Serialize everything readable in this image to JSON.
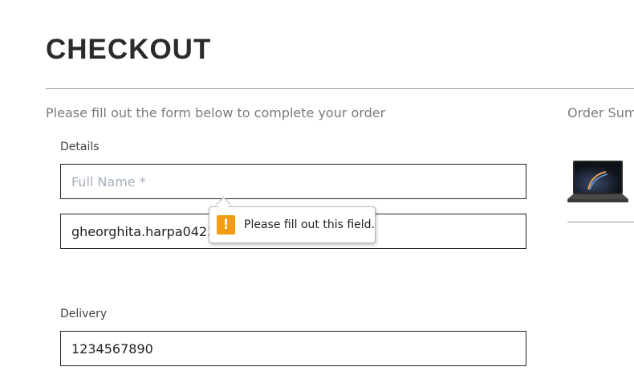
{
  "page": {
    "title": "CHECKOUT",
    "subtitle": "Please fill out the form below to complete your order"
  },
  "details": {
    "label": "Details",
    "full_name": {
      "value": "",
      "placeholder": "Full Name *"
    },
    "email": {
      "value": "gheorghita.harpa0423",
      "placeholder": ""
    }
  },
  "delivery": {
    "label": "Delivery",
    "phone": {
      "value": "1234567890",
      "placeholder": ""
    }
  },
  "summary": {
    "title": "Order Summary",
    "product_image": "laptop-thumbnail"
  },
  "validation": {
    "message": "Please fill out this field.",
    "icon": "warning-icon",
    "icon_glyph": "!",
    "icon_color": "#f39c12"
  }
}
